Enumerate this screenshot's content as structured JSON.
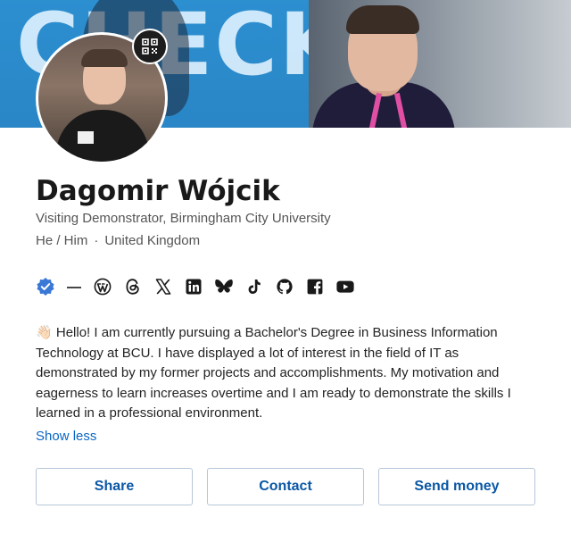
{
  "banner": {
    "text": "CHECK-IN"
  },
  "profile": {
    "name": "Dagomir Wójcik",
    "headline": "Visiting Demonstrator, Birmingham City University",
    "pronouns": "He / Him",
    "separator": "·",
    "location": "United Kingdom"
  },
  "icons": [
    "verified-badge-icon",
    "wordpress-icon",
    "threads-icon",
    "x-icon",
    "linkedin-icon",
    "bluesky-icon",
    "tiktok-icon",
    "github-icon",
    "facebook-icon",
    "youtube-icon"
  ],
  "bio": {
    "emoji": "👋🏻",
    "text": "Hello! I am currently pursuing a Bachelor's Degree in Business Information Technology at BCU. I have displayed a lot of interest in the field of IT as demonstrated by my former projects and accomplishments. My motivation and eagerness to learn increases overtime and I am ready to demonstrate the skills I learned in a professional environment.",
    "toggle": "Show less"
  },
  "actions": {
    "share": "Share",
    "contact": "Contact",
    "send_money": "Send money"
  },
  "colors": {
    "accent": "#0a66c2",
    "verified": "#3a78d6",
    "banner_blue": "#2c8fd0"
  }
}
